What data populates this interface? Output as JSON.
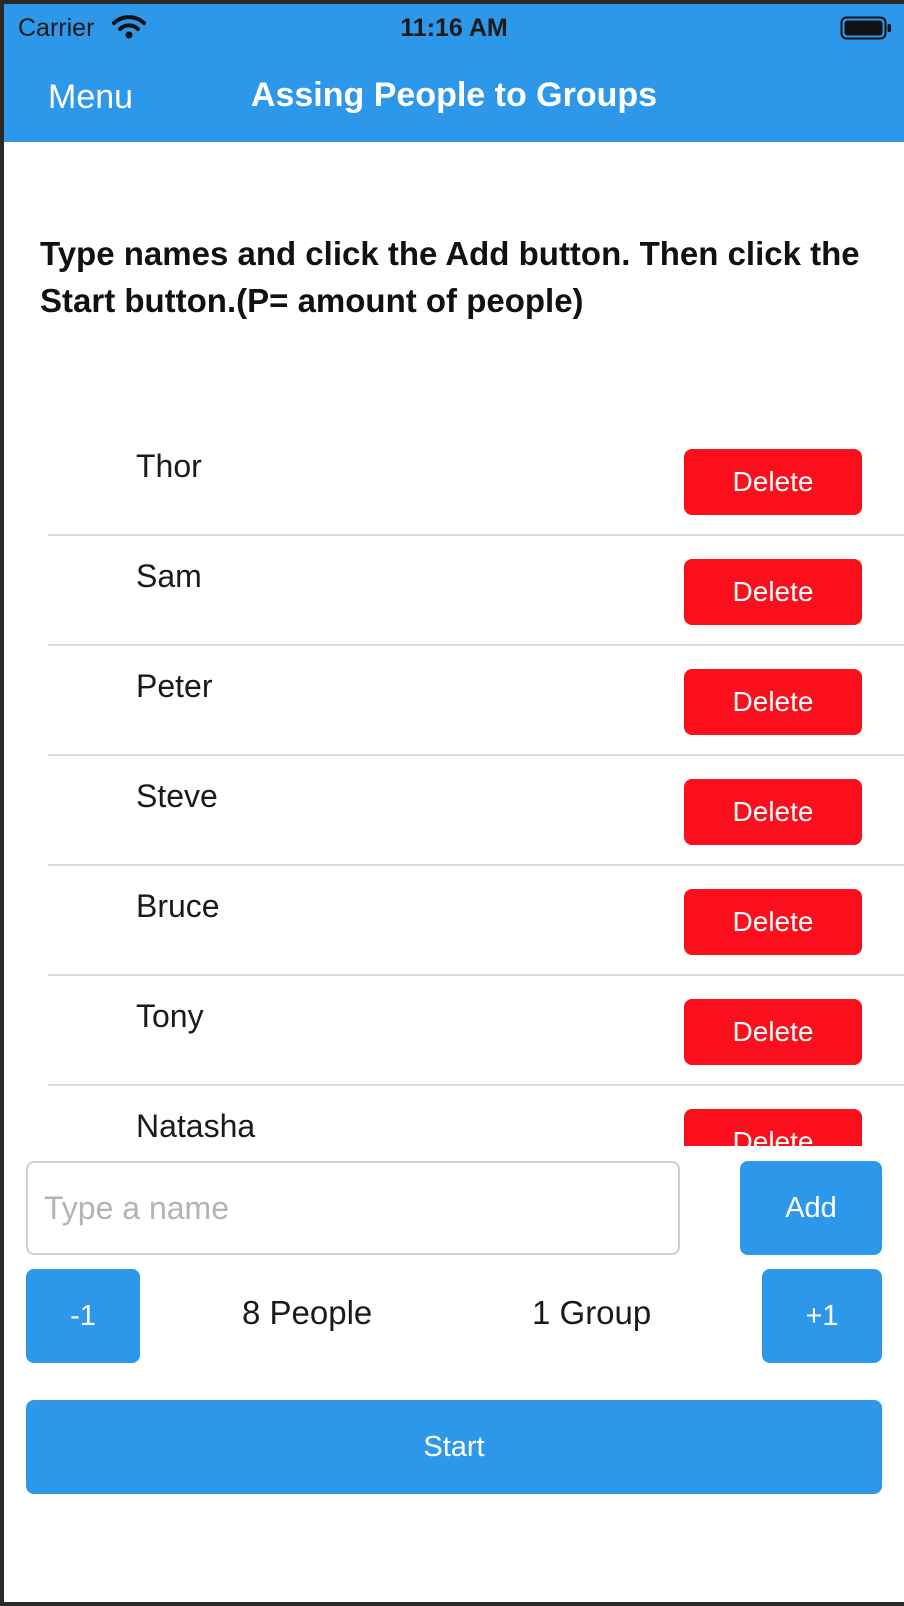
{
  "status_bar": {
    "carrier": "Carrier",
    "time": "11:16 AM"
  },
  "nav": {
    "menu_label": "Menu",
    "title": "Assing People to Groups"
  },
  "instructions": "Type names and click the Add button. Then click the Start button.(P= amount of people)",
  "people": [
    {
      "name": "Thor",
      "delete_label": "Delete"
    },
    {
      "name": "Sam",
      "delete_label": "Delete"
    },
    {
      "name": "Peter",
      "delete_label": "Delete"
    },
    {
      "name": "Steve",
      "delete_label": "Delete"
    },
    {
      "name": "Bruce",
      "delete_label": "Delete"
    },
    {
      "name": "Tony",
      "delete_label": "Delete"
    },
    {
      "name": "Natasha",
      "delete_label": "Delete"
    }
  ],
  "input": {
    "placeholder": "Type a name",
    "value": ""
  },
  "buttons": {
    "add": "Add",
    "minus": "-1",
    "plus": "+1",
    "start": "Start"
  },
  "counts": {
    "people": "8 People",
    "groups": "1 Group"
  },
  "colors": {
    "primary": "#2d98ea",
    "delete": "#fc0f1c",
    "background": "#ffffff"
  },
  "icons": {
    "wifi": "wifi-icon",
    "battery": "battery-icon"
  }
}
